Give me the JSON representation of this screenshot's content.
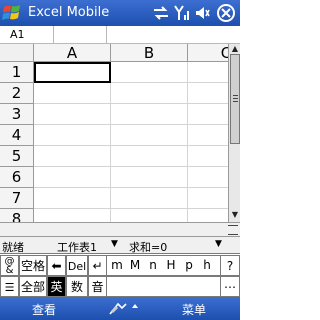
{
  "titlebar": {
    "title": "Excel Mobile",
    "icons": [
      "windows-logo-icon",
      "sync-arrows-icon",
      "signal-antenna-icon",
      "speaker-icon",
      "ok-close-icon"
    ]
  },
  "namebox": {
    "cell_ref": "A1",
    "formula": ""
  },
  "grid": {
    "columns": [
      "A",
      "B",
      "C"
    ],
    "rows": [
      "1",
      "2",
      "3",
      "4",
      "5",
      "6",
      "7",
      "8"
    ],
    "active_cell": "A1"
  },
  "statusbar": {
    "status": "就绪",
    "sheet": "工作表1",
    "sum": "求和=0"
  },
  "ime": {
    "row1": [
      "空格",
      "Del",
      "m",
      "M",
      "n",
      "H",
      "p",
      "h",
      "?"
    ],
    "row2": [
      "全部",
      "英",
      "数",
      "音"
    ],
    "row1_icons": [
      "at-symbols-icon",
      "backspace-arrow-icon",
      "enter-arrow-icon"
    ],
    "row2_icons": [
      "list-icon",
      "more-icon"
    ]
  },
  "menubar": {
    "left": "查看",
    "right": "菜单",
    "icons": [
      "input-panel-icon",
      "caret-up-icon"
    ]
  }
}
